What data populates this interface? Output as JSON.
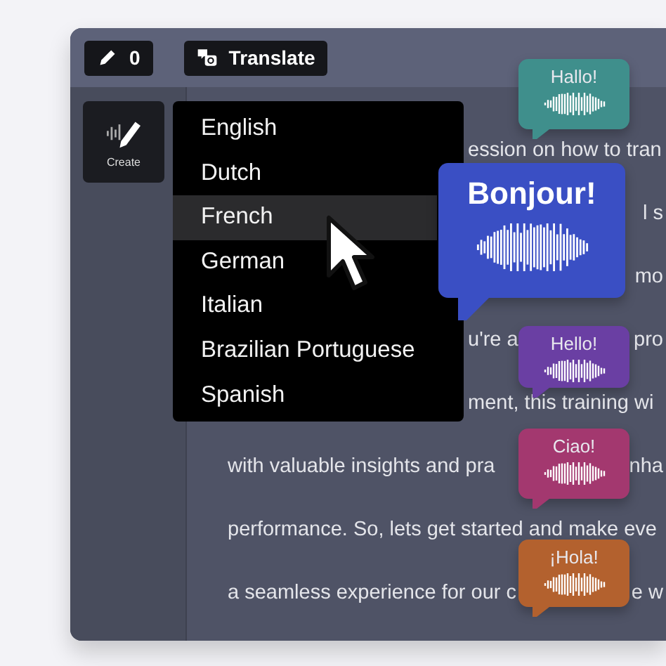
{
  "toolbar": {
    "edit_count": "0",
    "translate_label": "Translate"
  },
  "sidebar": {
    "create_label": "Create"
  },
  "language_menu": [
    {
      "label": "English",
      "selected": false
    },
    {
      "label": "Dutch",
      "selected": false
    },
    {
      "label": "French",
      "selected": true
    },
    {
      "label": "German",
      "selected": false
    },
    {
      "label": "Italian",
      "selected": false
    },
    {
      "label": "Brazilian Portuguese",
      "selected": false
    },
    {
      "label": "Spanish",
      "selected": false
    }
  ],
  "script_lines": [
    {
      "kind": "after_menu",
      "parts": [
        "ession on how to tran"
      ]
    },
    {
      "kind": "after_bubble",
      "parts": [
        "l s"
      ]
    },
    {
      "kind": "after_bubble",
      "parts": [
        "mo"
      ]
    },
    {
      "kind": "after_menu",
      "parts": [
        "u're a",
        "pro"
      ]
    },
    {
      "kind": "after_menu",
      "parts": [
        "ment, this training wi"
      ]
    },
    {
      "kind": "full",
      "parts": [
        "with valuable insights and pra",
        "nha"
      ]
    },
    {
      "kind": "full",
      "parts": [
        "performance. So, lets get started and make eve"
      ]
    },
    {
      "kind": "full",
      "parts": [
        "a seamless experience for our c",
        "e w"
      ]
    }
  ],
  "speech_bubbles": [
    {
      "text": "Hallo!",
      "color": "#3f8f8c",
      "kind": "small"
    },
    {
      "text": "Bonjour!",
      "color": "#3a4fc4",
      "kind": "large"
    },
    {
      "text": "Hello!",
      "color": "#6a3fa3",
      "kind": "small"
    },
    {
      "text": "Ciao!",
      "color": "#a3386f",
      "kind": "small"
    },
    {
      "text": "¡Hola!",
      "color": "#b3612e",
      "kind": "small"
    }
  ]
}
